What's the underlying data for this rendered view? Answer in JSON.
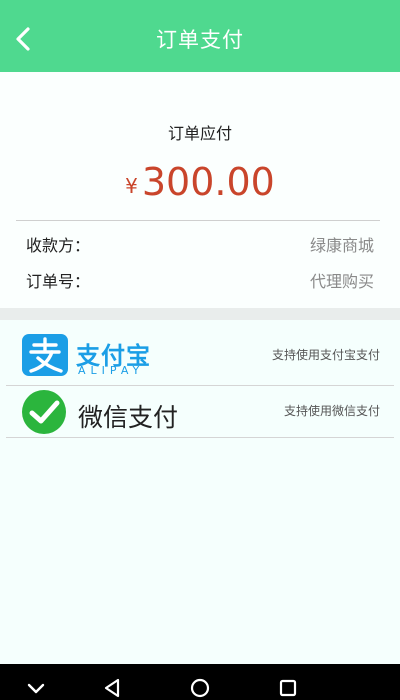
{
  "header": {
    "title": "订单支付",
    "back_icon": "chevron-left-icon"
  },
  "order": {
    "due_label": "订单应付",
    "currency_symbol": "¥",
    "amount": "300.00",
    "payee_label": "收款方：",
    "payee_value": "绿康商城",
    "order_no_label": "订单号：",
    "order_no_value": "代理购买"
  },
  "payment_methods": [
    {
      "name": "支付宝",
      "name_en": "ALIPAY",
      "note": "支持使用支付宝支付",
      "icon": "alipay-icon"
    },
    {
      "name": "微信支付",
      "note": "支持使用微信支付",
      "icon": "wechat-icon"
    }
  ],
  "colors": {
    "header": "#4fd98f",
    "amount": "#c9452b",
    "alipay": "#1b9ee6",
    "wechat": "#2bb53d"
  },
  "system_nav": {
    "icons": [
      "chevron-down-icon",
      "back-triangle-icon",
      "home-circle-icon",
      "recents-square-icon"
    ]
  }
}
